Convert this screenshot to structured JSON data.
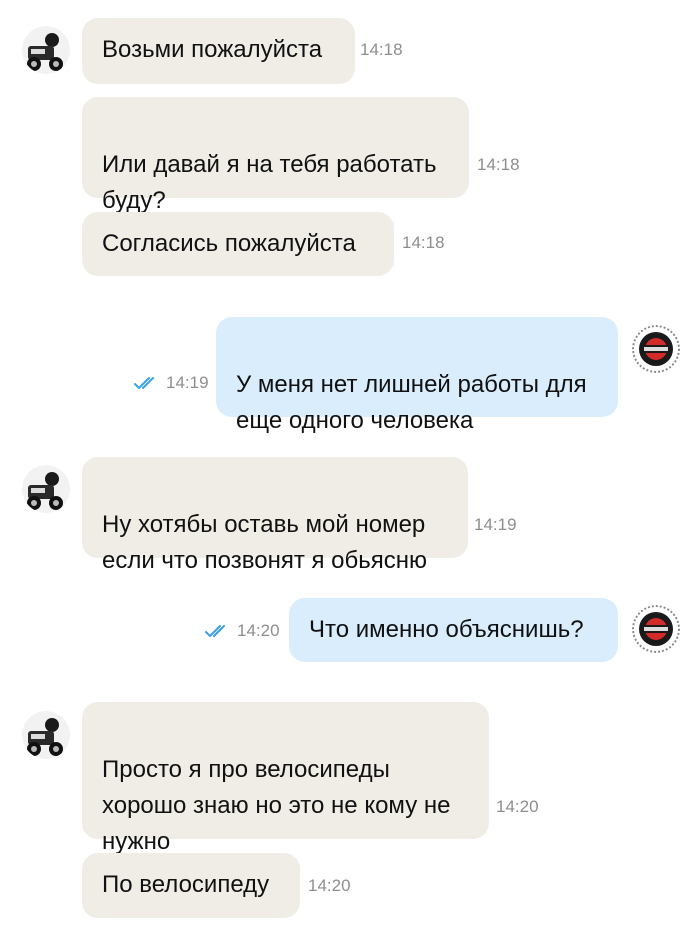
{
  "chat": {
    "messages": [
      {
        "text": "Возьми пожалуйста",
        "time": "14:18"
      },
      {
        "text": "Или давай я на тебя работать\nбуду?",
        "time": "14:18"
      },
      {
        "text": "Согласись пожалуйста",
        "time": "14:18"
      },
      {
        "text": "У меня нет лишней работы для\nеще одного человека",
        "time": "14:19",
        "status": "read"
      },
      {
        "text": "Ну хотябы оставь мой номер\nесли что позвонят я обьясню",
        "time": "14:19"
      },
      {
        "text": "Что именно объяснишь?",
        "time": "14:20",
        "status": "read"
      },
      {
        "text": "Просто я про велосипеды\nхорошо знаю но это не кому не\nнужно",
        "time": "14:20"
      },
      {
        "text": "По велосипеду",
        "time": "14:20"
      }
    ],
    "colors": {
      "incoming_bubble": "#efede6",
      "outgoing_bubble": "#d9edfd",
      "read_check": "#3aa0e8",
      "timestamp": "#8e8e8e"
    },
    "icons": {
      "contact_avatar": "motorcycle-avatar-icon",
      "own_avatar": "bike-point-logo-icon",
      "read_status": "double-check-icon"
    }
  }
}
